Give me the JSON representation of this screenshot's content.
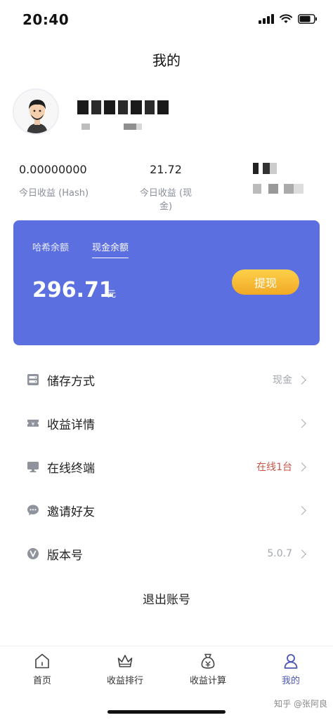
{
  "status_bar": {
    "time": "20:40"
  },
  "page": {
    "title": "我的"
  },
  "stats": [
    {
      "value": "0.00000000",
      "label": "今日收益 (Hash)"
    },
    {
      "value": "21.72",
      "label": "今日收益 (现金)"
    }
  ],
  "balance_card": {
    "tabs": [
      "哈希余额",
      "现金余额"
    ],
    "active_tab": "现金余额",
    "amount": "296.71",
    "currency": "元",
    "withdraw_label": "提现",
    "background_color": "#5b6fe0"
  },
  "menu": [
    {
      "label": "储存方式",
      "value": "现金",
      "icon": "storage-icon"
    },
    {
      "label": "收益详情",
      "value": "",
      "icon": "ticket-icon"
    },
    {
      "label": "在线终端",
      "value": "在线1台",
      "icon": "monitor-icon"
    },
    {
      "label": "邀请好友",
      "value": "",
      "icon": "chat-bubble-icon"
    },
    {
      "label": "版本号",
      "value": "5.0.7",
      "icon": "version-icon"
    }
  ],
  "logout_label": "退出账号",
  "tabbar": {
    "items": [
      {
        "label": "首页",
        "icon": "home-icon"
      },
      {
        "label": "收益排行",
        "icon": "crown-icon"
      },
      {
        "label": "收益计算",
        "icon": "money-bag-icon"
      },
      {
        "label": "我的",
        "icon": "person-icon"
      }
    ],
    "active": "我的"
  },
  "watermark": "知乎 @张阿良"
}
